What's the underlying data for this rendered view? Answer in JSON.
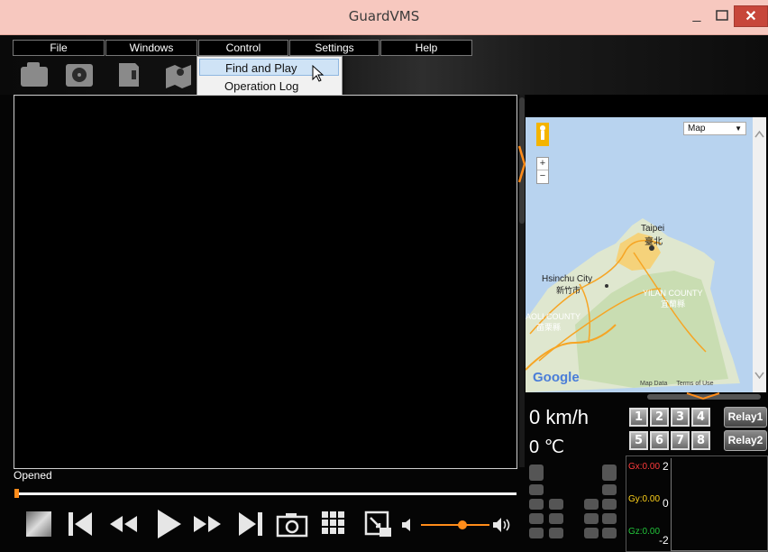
{
  "window": {
    "title": "GuardVMS",
    "minimize": "_",
    "maximize": "□",
    "close": "✕"
  },
  "menu": [
    {
      "label": "File"
    },
    {
      "label": "Windows"
    },
    {
      "label": "Control"
    },
    {
      "label": "Settings"
    },
    {
      "label": "Help"
    }
  ],
  "toolbar_icons": [
    "folder-icon",
    "hard-drive-icon",
    "sd-card-icon",
    "map-export-icon"
  ],
  "control_menu": {
    "items": [
      {
        "label": "Find and Play"
      },
      {
        "label": "Operation Log"
      }
    ],
    "highlighted": "Find and Play"
  },
  "player": {
    "status": "Opened",
    "progress": 0.0,
    "volume": 0.6,
    "buttons": [
      "stop-icon",
      "skip-previous-icon",
      "rewind-icon",
      "play-icon",
      "fast-forward-icon",
      "skip-next-icon",
      "camera-icon",
      "grid-icon",
      "avi-export-icon",
      "volume-icon"
    ]
  },
  "map": {
    "type_select": "Map",
    "labels": {
      "taipei": "Taipei",
      "taipei_zh": "臺北",
      "hsinchu": "Hsinchu City",
      "hsinchu_zh": "新竹市",
      "yilan": "YILAN COUNTY",
      "yilan_zh": "宜蘭縣",
      "miaoli": "AOLI COUNTY",
      "miaoli_zh": "苗栗縣"
    },
    "logo": "Google",
    "footer": {
      "map_data": "Map Data",
      "terms": "Terms of Use"
    },
    "zoom_in": "+",
    "zoom_out": "−"
  },
  "sensors": {
    "speed": "0 km/h",
    "temperature": "0 ℃",
    "channels": [
      "1",
      "2",
      "3",
      "4",
      "5",
      "6",
      "7",
      "8"
    ],
    "relays": [
      "Relay1",
      "Relay2"
    ]
  },
  "gsensor": {
    "gx": "Gx:0.00",
    "gy": "Gy:0.00",
    "gz": "Gz:0.00",
    "y_ticks": [
      "2",
      "0",
      "-2"
    ],
    "colors": {
      "gx": "#ff3b3b",
      "gy": "#ffd21a",
      "gz": "#22c43a"
    }
  },
  "accent": "#ff8c1a"
}
